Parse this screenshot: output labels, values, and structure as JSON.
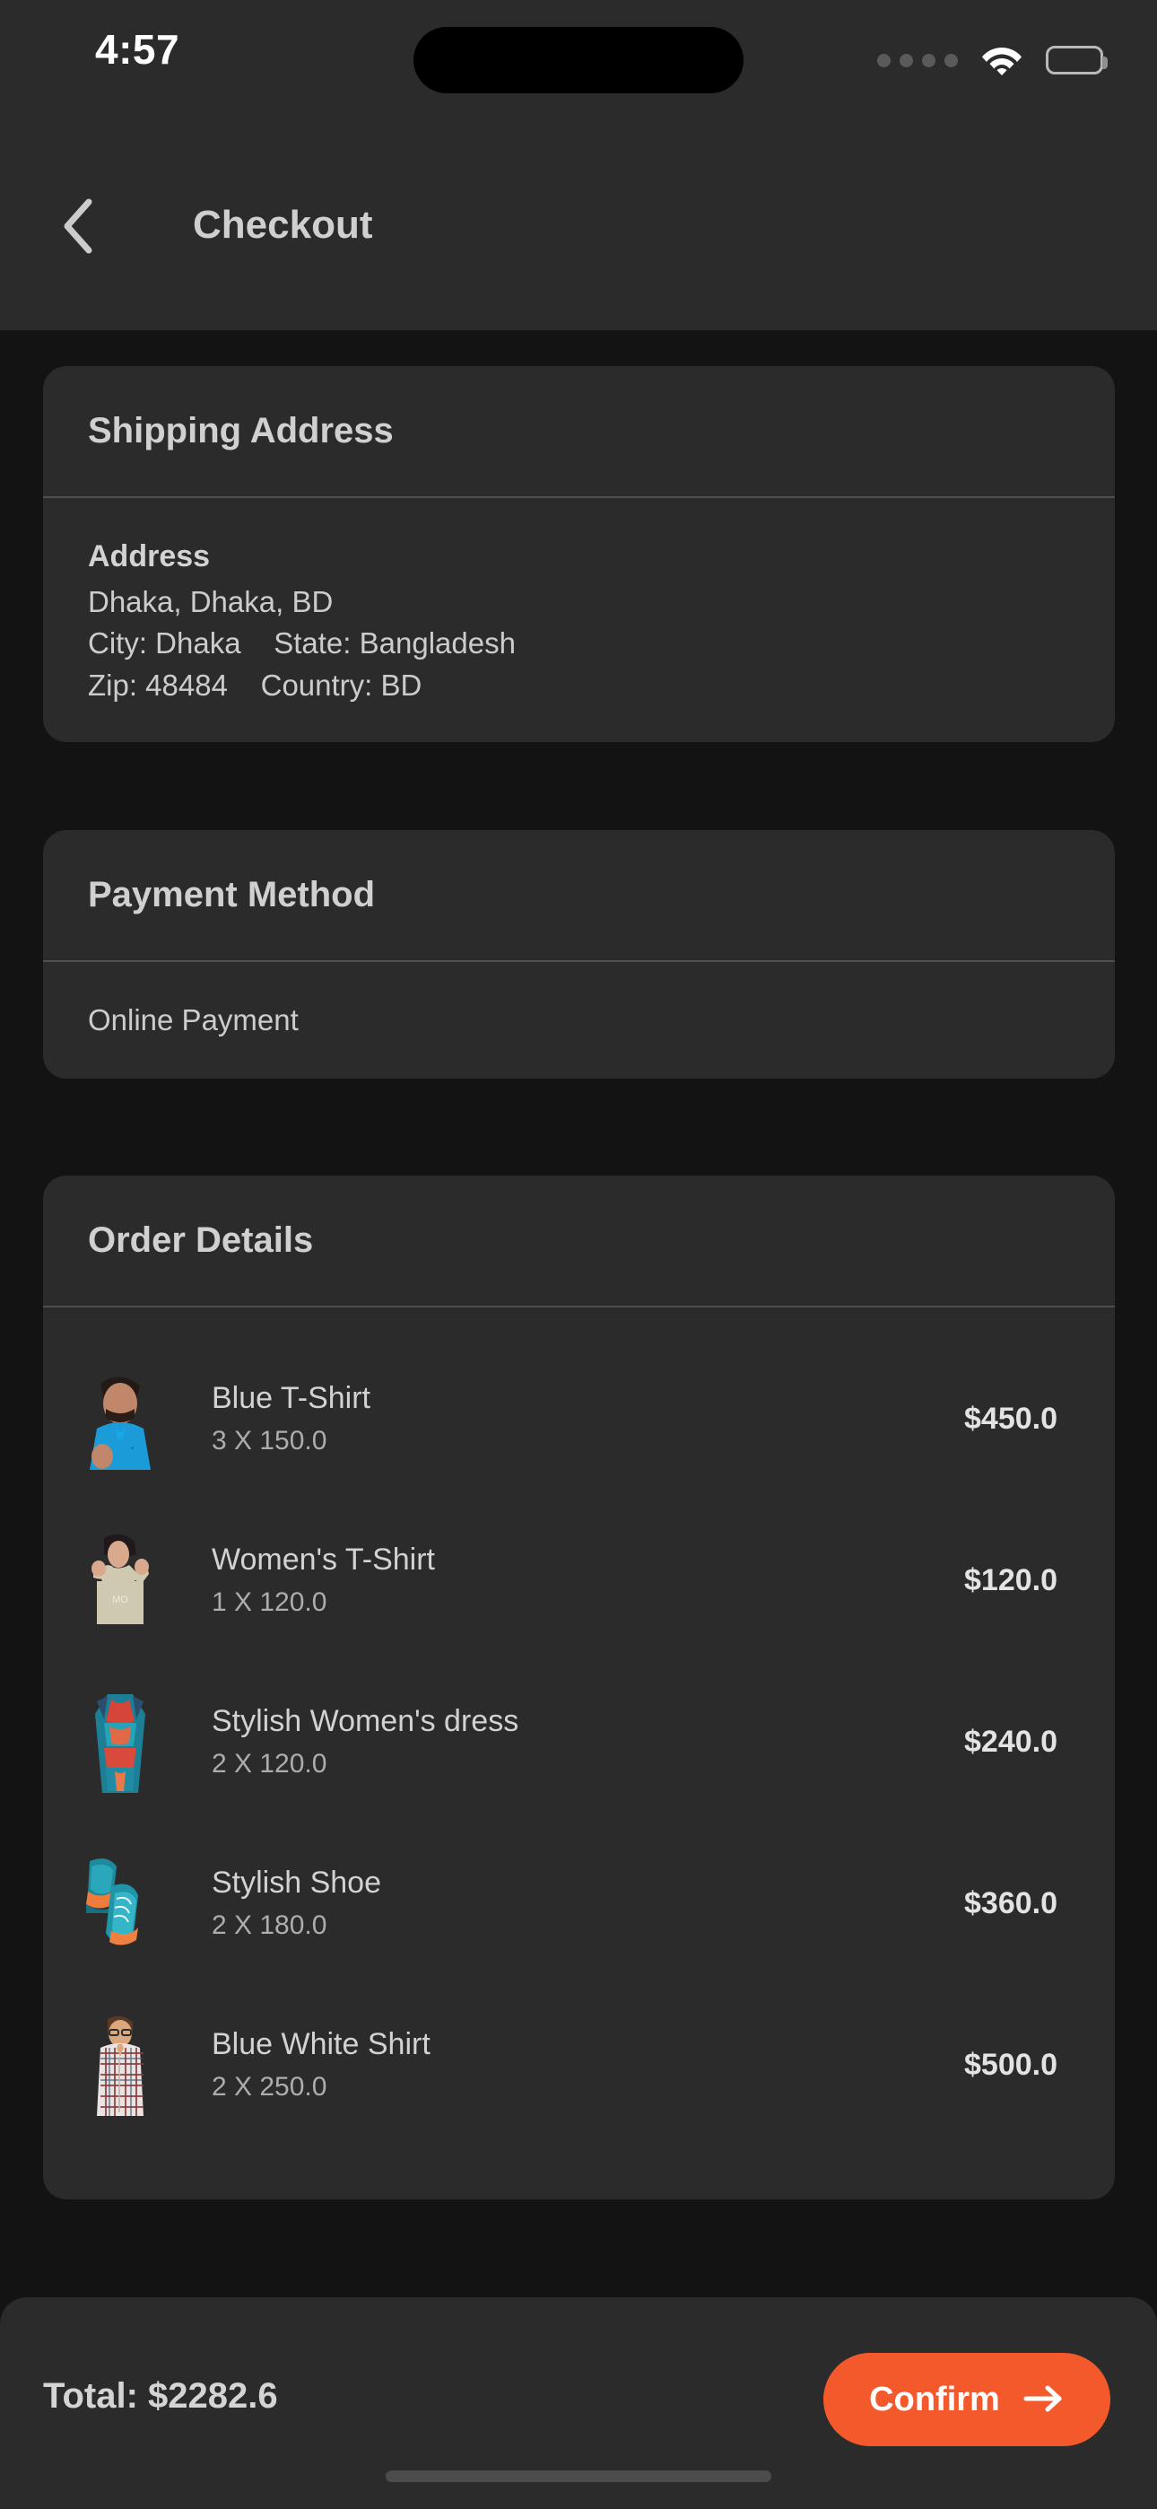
{
  "status_bar": {
    "time": "4:57",
    "icons": [
      "signal-dots-icon",
      "wifi-icon",
      "battery-icon"
    ],
    "battery_level": "full"
  },
  "app_bar": {
    "back_icon": "chevron-left-icon",
    "title": "Checkout"
  },
  "shipping_address": {
    "section_title": "Shipping Address",
    "label": "Address",
    "line1": "Dhaka, Dhaka, BD",
    "line2": "City: Dhaka    State: Bangladesh",
    "line3": "Zip: 48484    Country: BD"
  },
  "payment_method": {
    "section_title": "Payment Method",
    "value": "Online Payment"
  },
  "order_details": {
    "section_title": "Order Details",
    "items": [
      {
        "name": "Blue T-Shirt",
        "qty_line": "3 X 150.0",
        "price": "$450.0",
        "thumb": "blue-tshirt-photo"
      },
      {
        "name": "Women's T-Shirt",
        "qty_line": "1 X 120.0",
        "price": "$120.0",
        "thumb": "womens-tshirt-photo"
      },
      {
        "name": "Stylish Women's dress",
        "qty_line": "2 X 120.0",
        "price": "$240.0",
        "thumb": "womens-dress-photo"
      },
      {
        "name": "Stylish Shoe",
        "qty_line": "2 X 180.0",
        "price": "$360.0",
        "thumb": "stylish-shoe-photo"
      },
      {
        "name": "Blue White Shirt",
        "qty_line": "2 X 250.0",
        "price": "$500.0",
        "thumb": "blue-white-shirt-photo"
      }
    ]
  },
  "bottom_bar": {
    "total_label": "Total: $2282.6",
    "confirm_label": "Confirm",
    "confirm_icon": "arrow-right-icon"
  },
  "colors": {
    "page_background": "#131313",
    "card_background": "#2b2b2b",
    "divider": "#4f4f4f",
    "accent_orange": "#f4592b",
    "primary_text": "#d2d2d2",
    "secondary_text": "#adadad"
  }
}
